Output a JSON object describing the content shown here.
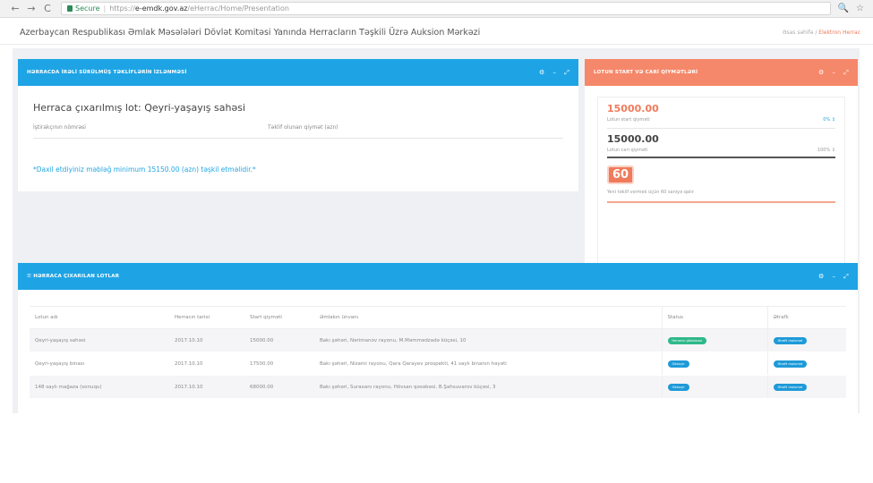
{
  "browser": {
    "back": "←",
    "forward": "→",
    "reload": "C",
    "secure_label": "Secure",
    "url_scheme": "https://",
    "url_host": "e-emdk.gov.az",
    "url_path": "/eHerrac/Home/Presentation",
    "zoom_icon": "🔍",
    "star_icon": "☆"
  },
  "header": {
    "title": "Azerbaycan Respublikası Əmlak Məsələləri Dövlət Komitəsi Yanında Herracların Təşkili Üzrə Auksion Mərkəzi",
    "breadcrumb_home": "Əsas səhifə",
    "breadcrumb_sep": "/",
    "breadcrumb_current": "Elektron Herrac"
  },
  "left_panel": {
    "heading": "HƏRRACDA İRƏLİ SÜRÜLMÜŞ TƏKLİFLƏRİN İZLƏNMƏSİ",
    "lot_title": "Herraca çıxarılmış lot: Qeyri-yaşayış sahəsi",
    "col_participant": "İştirakçının nömrəsi",
    "col_offer": "Təklif olunan qiymət (azn)",
    "notice": "*Daxil etdiyiniz məbləğ minimum 15150.00 (azn) təşkil etməlidir.*"
  },
  "right_panel": {
    "heading": "LOTUN START VƏ CARİ QİYMƏTLƏRİ",
    "start_price": "15000.00",
    "start_label": "Lotun start qiyməti",
    "start_pct": "0% ↕",
    "current_price": "15000.00",
    "current_label": "Lotun cari qiyməti",
    "current_pct": "100% ↕",
    "timer": "60",
    "timer_note": "Yeni təklif vermek üçün 60 saniyə qalır"
  },
  "lots_panel": {
    "heading": "☰ HƏRRACA ÇIXARILAN LOTLAR",
    "columns": [
      "Lotun adı",
      "Herracın tarixi",
      "Start qiyməti",
      "Əmlakın ünvanı",
      "Status",
      "Ətraflı"
    ],
    "rows": [
      {
        "name": "Qeyri-yaşayış sahəsi",
        "date": "2017.10.10",
        "price": "15000.00",
        "address": "Bakı şəhəri, Nərimanov rayonu, M.Məmmədzadə küçəsi, 10",
        "status": "Herracın gözləməsi",
        "status_color": "green",
        "detail": "Ətraflı məlumat"
      },
      {
        "name": "Qeyri-yaşayış binası",
        "date": "2017.10.10",
        "price": "17500.00",
        "address": "Bakı şəhəri, Nizami rayonu, Qara Qarayev prospekti, 41 saylı binanın həyəti",
        "status": "Gözləyir",
        "status_color": "blue",
        "detail": "Ətraflı məlumat"
      },
      {
        "name": "148 saylı mağaza (sonuqu)",
        "date": "2017.10.10",
        "price": "68000.00",
        "address": "Bakı şəhəri, Suraxanı rayonu, Hövsan qəsəbəsi, B.Şahsuvarov küçəsi, 3",
        "status": "Gözləyir",
        "status_color": "blue",
        "detail": "Ətraflı məlumat"
      }
    ]
  },
  "panel_tools": {
    "settings": "⚙",
    "minimize": "–",
    "expand": "⤢"
  },
  "colors": {
    "blue": "#1ea4e5",
    "orange": "#f5886a",
    "green": "#2fb889"
  }
}
